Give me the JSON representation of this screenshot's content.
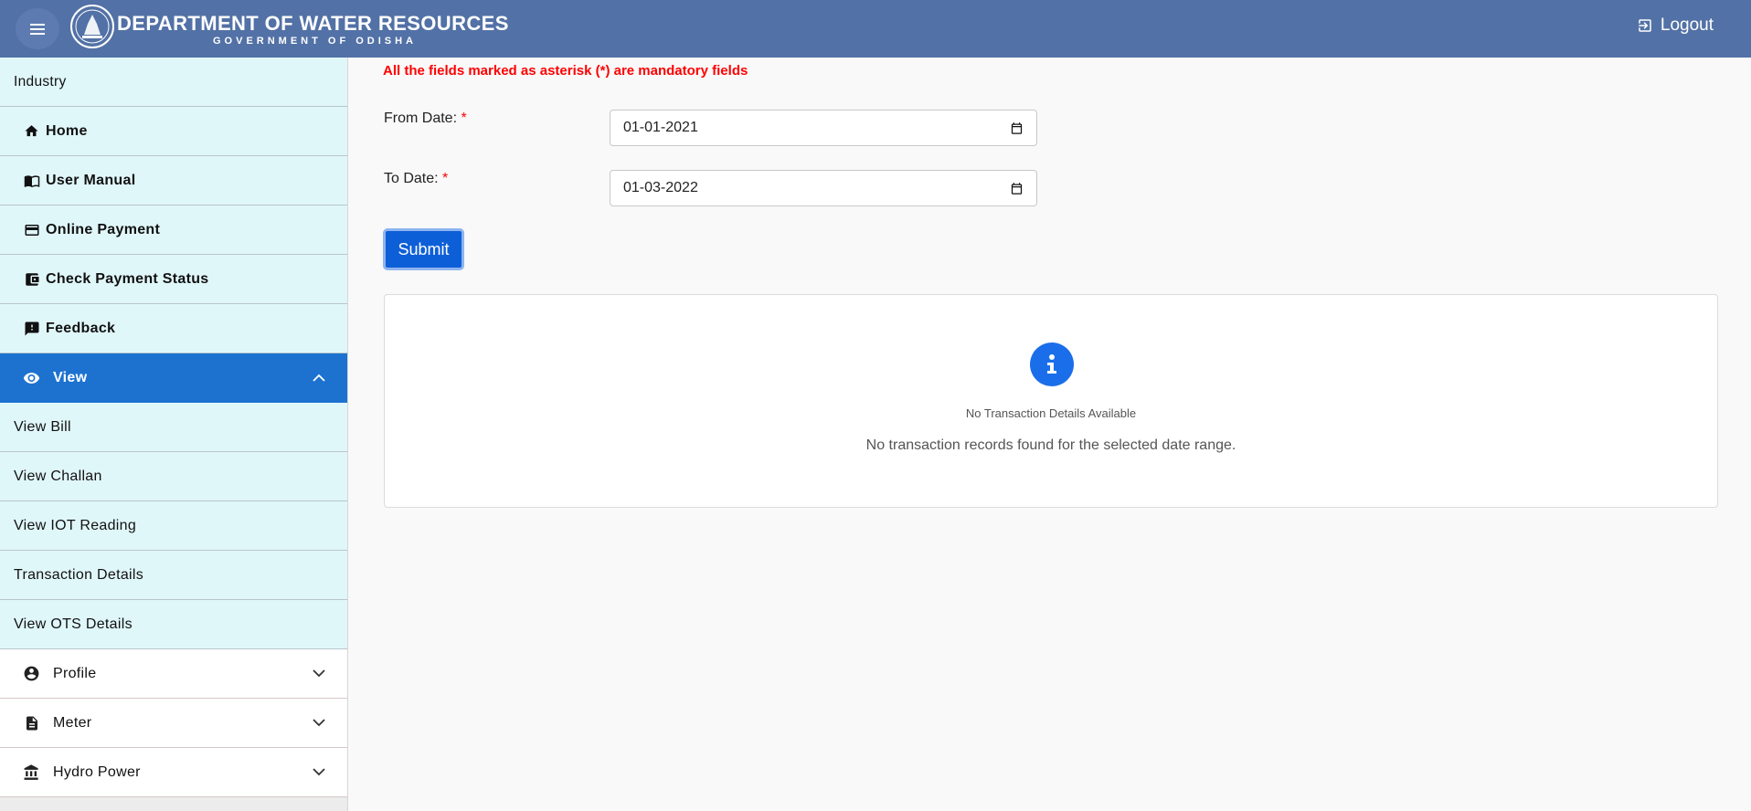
{
  "header": {
    "title": "DEPARTMENT OF WATER RESOURCES",
    "subtitle": "GOVERNMENT OF ODISHA",
    "logout_label": "Logout"
  },
  "sidebar": {
    "section_label": "Industry",
    "items": [
      {
        "label": "Home",
        "icon": "home-icon"
      },
      {
        "label": "User Manual",
        "icon": "book-icon"
      },
      {
        "label": "Online Payment",
        "icon": "credit-card-icon"
      },
      {
        "label": "Check Payment Status",
        "icon": "wallet-icon"
      },
      {
        "label": "Feedback",
        "icon": "feedback-icon"
      }
    ],
    "view_group": {
      "label": "View",
      "icon": "eye-icon",
      "expanded": true,
      "children": [
        "View Bill",
        "View Challan",
        "View IOT Reading",
        "Transaction Details",
        "View OTS Details"
      ]
    },
    "collapsed_groups": [
      {
        "label": "Profile",
        "icon": "account-circle-icon"
      },
      {
        "label": "Meter",
        "icon": "document-icon"
      },
      {
        "label": "Hydro Power",
        "icon": "bank-icon"
      }
    ]
  },
  "form": {
    "mandatory_note": "All the fields marked as asterisk (*) are mandatory fields",
    "from_label": "From Date:",
    "from_value": "01-01-2021",
    "to_label": "To Date:",
    "to_value": "01-03-2022",
    "required_mark": "*",
    "submit_label": "Submit"
  },
  "result": {
    "icon": "info-icon",
    "title": "No Transaction Details Available",
    "message": "No transaction records found for the selected date range."
  },
  "colors": {
    "header": "#5271a6",
    "sidebar_item": "#e0f7fa",
    "active": "#1d72d0",
    "submit": "#0d5fd8",
    "required": "#ff0000",
    "info": "#1a6eea"
  }
}
